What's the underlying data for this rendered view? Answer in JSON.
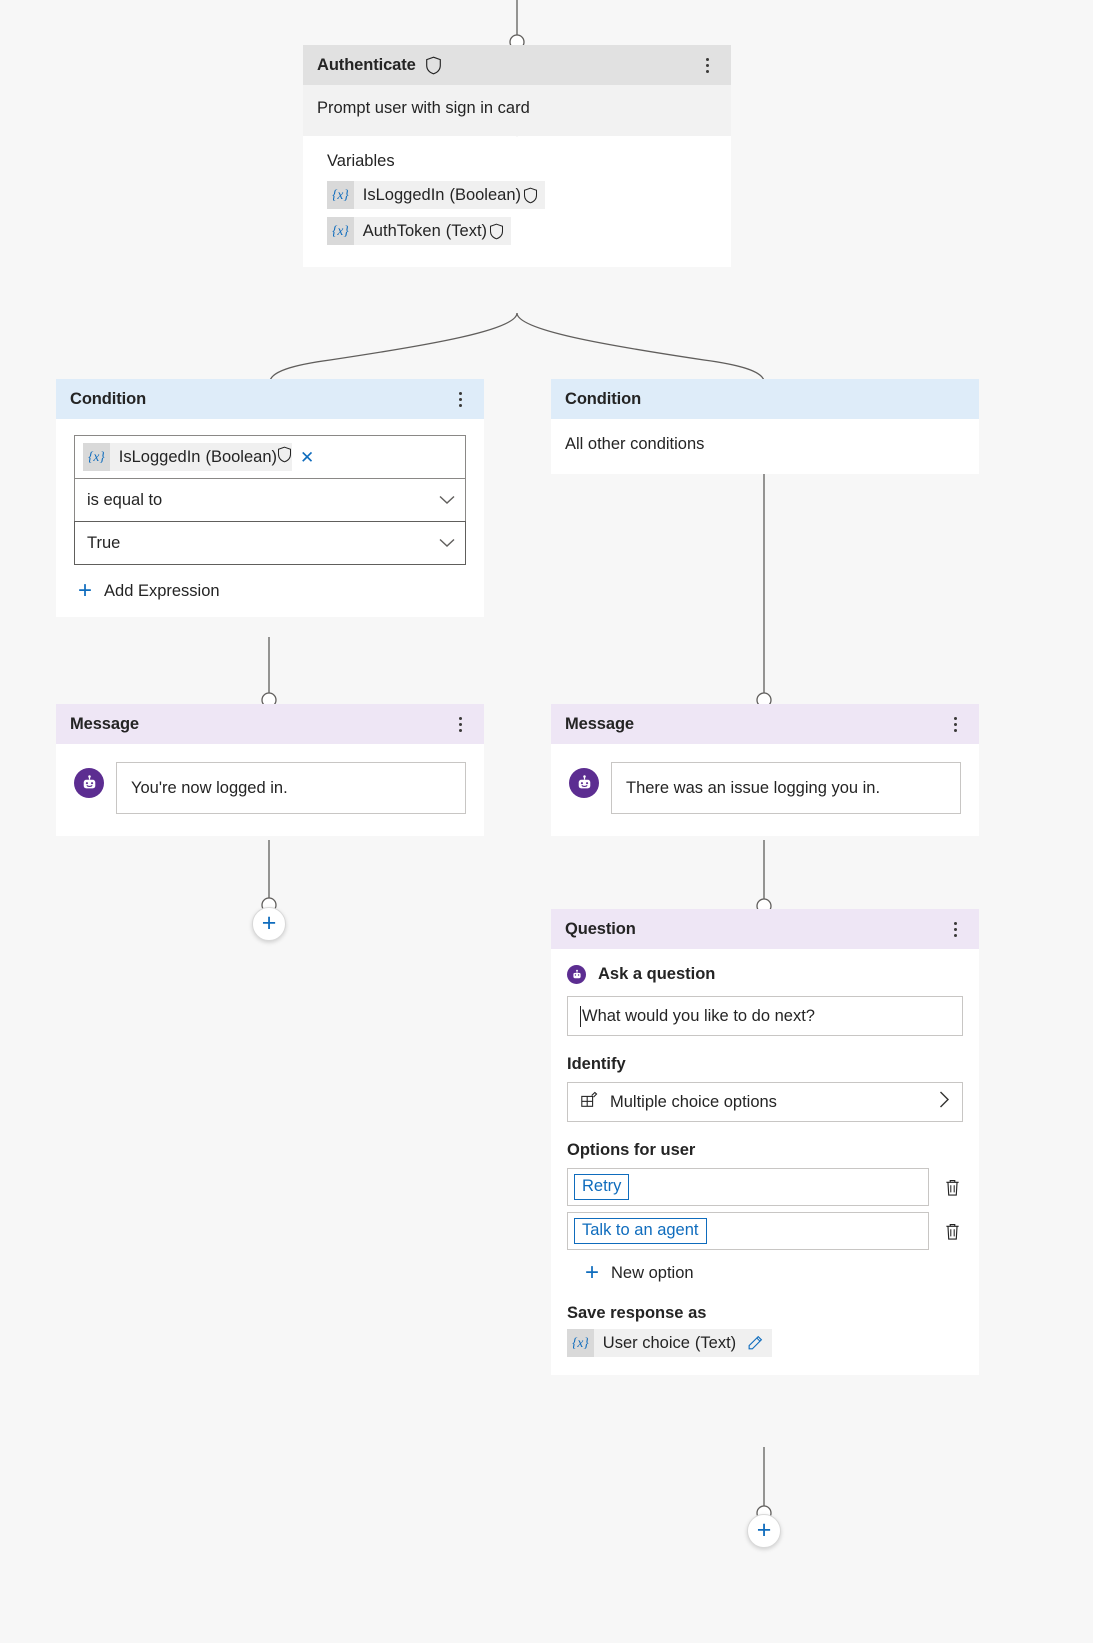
{
  "canvas": {
    "background": "#f7f7f7",
    "accent_blue": "#0f6cbd",
    "bot_purple": "#5c2d91",
    "header_grey": "#e1e1e1",
    "header_blue": "#deecf9",
    "header_purple": "#eee6f5"
  },
  "nodes": {
    "authenticate": {
      "title": "Authenticate",
      "shield_icon": "shield-icon",
      "kebab_icon": "more-options-icon",
      "subtitle": "Prompt user with sign in card",
      "variables_label": "Variables",
      "variables": [
        {
          "token": "{x}",
          "name": "IsLoggedIn",
          "type": "(Boolean)",
          "shield_icon": "shield-icon"
        },
        {
          "token": "{x}",
          "name": "AuthToken",
          "type": "(Text)",
          "shield_icon": "shield-icon"
        }
      ]
    },
    "condition_true": {
      "title": "Condition",
      "kebab_icon": "more-options-icon",
      "variable": {
        "token": "{x}",
        "name": "IsLoggedIn",
        "type": "(Boolean)",
        "shield_icon": "shield-icon",
        "remove_icon": "close-icon"
      },
      "operator": "is equal to",
      "value": "True",
      "add_expression_label": "Add Expression",
      "add_expression_icon": "plus-icon"
    },
    "condition_else": {
      "title": "Condition",
      "subtitle": "All other conditions"
    },
    "message_success": {
      "title": "Message",
      "kebab_icon": "more-options-icon",
      "avatar_icon": "bot-avatar-icon",
      "text": "You're now logged in."
    },
    "message_failure": {
      "title": "Message",
      "kebab_icon": "more-options-icon",
      "avatar_icon": "bot-avatar-icon",
      "text": "There was an issue logging you in."
    },
    "question": {
      "title": "Question",
      "kebab_icon": "more-options-icon",
      "ask_label": "Ask a question",
      "ask_icon": "bot-dot-icon",
      "question_text": "What would you like to do next?",
      "identify_label": "Identify",
      "identify_value": "Multiple choice options",
      "identify_icon": "multiple-choice-icon",
      "identify_chevron": "chevron-right-icon",
      "options_label": "Options for user",
      "options": [
        {
          "label": "Retry",
          "delete_icon": "trash-icon"
        },
        {
          "label": "Talk to an agent",
          "delete_icon": "trash-icon"
        }
      ],
      "new_option_label": "New option",
      "new_option_icon": "plus-icon",
      "save_response_label": "Save response as",
      "save_variable": {
        "token": "{x}",
        "name": "User choice",
        "type": "(Text)",
        "edit_icon": "pencil-icon"
      }
    }
  },
  "add_buttons": [
    {
      "name": "add-node-left-branch",
      "icon": "plus-icon"
    },
    {
      "name": "add-node-right-branch",
      "icon": "plus-icon"
    }
  ]
}
